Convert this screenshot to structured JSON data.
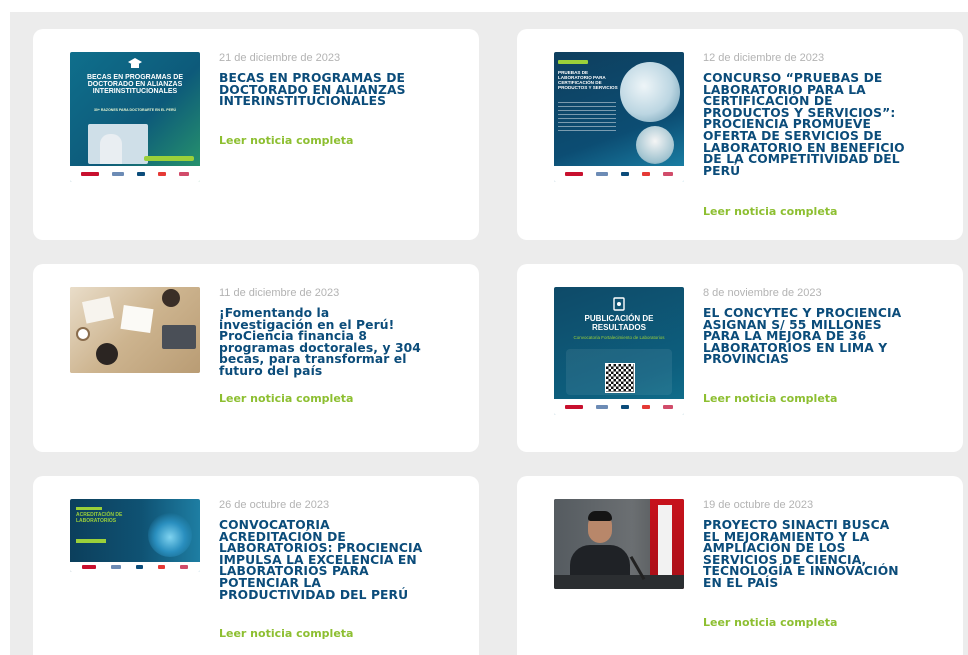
{
  "news": [
    {
      "date": "21 de diciembre de 2023",
      "title": "BECAS EN PROGRAMAS DE DOCTORADO EN ALIANZAS INTERINSTITUCIONALES",
      "link": "Leer noticia completa",
      "image": {
        "icon": "graduation-cap-icon",
        "headline": "BECAS EN PROGRAMAS DE DOCTORADO EN ALIANZAS INTERINSTITUCIONALES",
        "sub": "30+ RAZONES PARA DOCTORARTE EN EL PERÚ"
      }
    },
    {
      "date": "12 de diciembre de 2023",
      "title": "CONCURSO “PRUEBAS DE LABORATORIO PARA LA CERTIFICACIÓN DE PRODUCTOS Y SERVICIOS”: PROCIENCIA PROMUEVE OFERTA DE SERVICIOS DE LABORATORIO EN BENEFICIO DE LA COMPETITIVIDAD DEL PERÚ",
      "link": "Leer noticia completa",
      "image": {
        "headline": "PRUEBAS DE LABORATORIO PARA CERTIFICACIÓN DE PRODUCTOS Y SERVICIOS"
      }
    },
    {
      "date": "11 de diciembre de 2023",
      "title": "¡Fomentando la investigación en el Perú! ProCiencia financia 8 programas doctorales, y 304 becas, para transformar el futuro del país",
      "link": "Leer noticia completa",
      "image": {}
    },
    {
      "date": "8 de noviembre de 2023",
      "title": "EL CONCYTEC Y PROCIENCIA ASIGNAN S/ 55 MILLONES PARA LA MEJORA DE 36 LABORATORIOS EN LIMA Y PROVINCIAS",
      "link": "Leer noticia completa",
      "image": {
        "icon": "document-icon",
        "headline": "PUBLICACIÓN DE RESULTADOS",
        "sub": "Convocatoria Fortalecimiento de Laboratorios"
      }
    },
    {
      "date": "26 de octubre de 2023",
      "title": "CONVOCATORIA ACREDITACIÓN DE LABORATORIOS: PROCIENCIA IMPULSA LA EXCELENCIA EN LABORATORIOS PARA POTENCIAR LA PRODUCTIVIDAD DEL PERÚ",
      "link": "Leer noticia completa",
      "image": {
        "headline": "ACREDITACIÓN DE LABORATORIOS"
      }
    },
    {
      "date": "19 de octubre de 2023",
      "title": "PROYECTO SINACTI BUSCA EL MEJORAMIENTO Y LA AMPLIACIÓN DE LOS SERVICIOS DE CIENCIA, TECNOLOGÍA E INNOVACIÓN EN EL PAÍS",
      "link": "Leer noticia completa",
      "image": {}
    }
  ],
  "colors": {
    "title": "#0b4c7a",
    "date": "#b3b3b3",
    "link": "#8dbf31",
    "background": "#ececec"
  }
}
